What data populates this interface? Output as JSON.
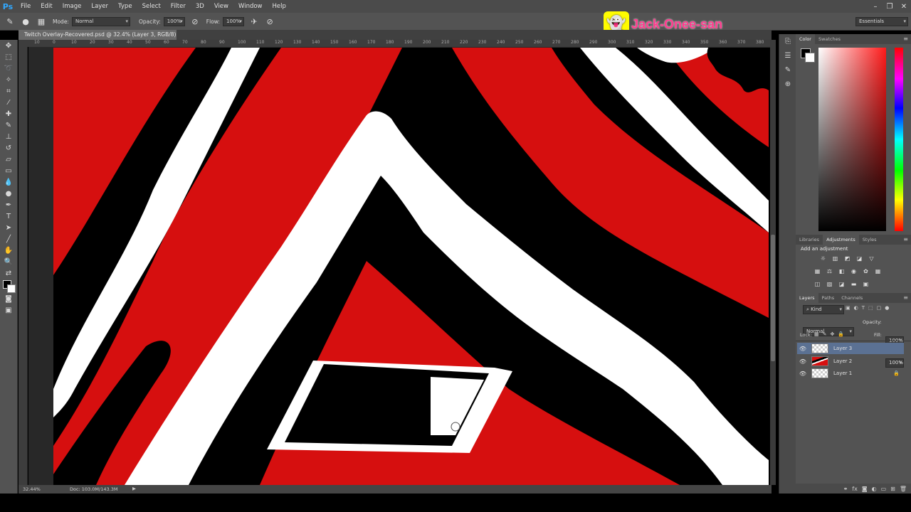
{
  "app": {
    "logo": "Ps"
  },
  "menu": [
    "File",
    "Edit",
    "Image",
    "Layer",
    "Type",
    "Select",
    "Filter",
    "3D",
    "View",
    "Window",
    "Help"
  ],
  "window_controls": [
    "–",
    "❐",
    "✕"
  ],
  "options": {
    "mode_label": "Mode:",
    "mode_value": "Normal",
    "opacity_label": "Opacity:",
    "opacity_value": "100%",
    "flow_label": "Flow:",
    "flow_value": "100%"
  },
  "workspace": "Essentials",
  "document": {
    "tab_title": "Twitch Overlay-Recovered.psd @ 32.4% (Layer 3, RGB/8) *"
  },
  "ruler_ticks": [
    "10",
    "0",
    "10",
    "20",
    "30",
    "40",
    "50",
    "60",
    "70",
    "80",
    "90",
    "100",
    "110",
    "120",
    "130",
    "140",
    "150",
    "160",
    "170",
    "180",
    "190",
    "200",
    "210",
    "220",
    "230",
    "240",
    "250",
    "260",
    "270",
    "280",
    "290",
    "300",
    "310",
    "320",
    "330",
    "340",
    "350",
    "360",
    "370",
    "380"
  ],
  "status": {
    "zoom": "32.44%",
    "doc": "Doc: 103.0M/143.3M"
  },
  "watermark": {
    "text": "Jack-Onee-san",
    "icon": "snapchat-ghost-icon"
  },
  "panels": {
    "color_tabs": [
      "Color",
      "Swatches"
    ],
    "adjust_tabs": [
      "Libraries",
      "Adjustments",
      "Styles"
    ],
    "adjust_title": "Add an adjustment",
    "layer_tabs": [
      "Layers",
      "Paths",
      "Channels"
    ],
    "kind_label": "Kind",
    "blend_mode": "Normal",
    "opacity_label": "Opacity:",
    "opacity_value": "100%",
    "lock_label": "Lock:",
    "fill_label": "Fill:",
    "fill_value": "100%"
  },
  "layers": [
    {
      "name": "Layer 3",
      "selected": true
    },
    {
      "name": "Layer 2",
      "selected": false
    },
    {
      "name": "Layer 1",
      "selected": false,
      "locked": true
    }
  ],
  "colors": {
    "canvas_red": "#d60f0f",
    "accent_blue": "#31a8ff",
    "selected_layer": "#5b7193"
  }
}
